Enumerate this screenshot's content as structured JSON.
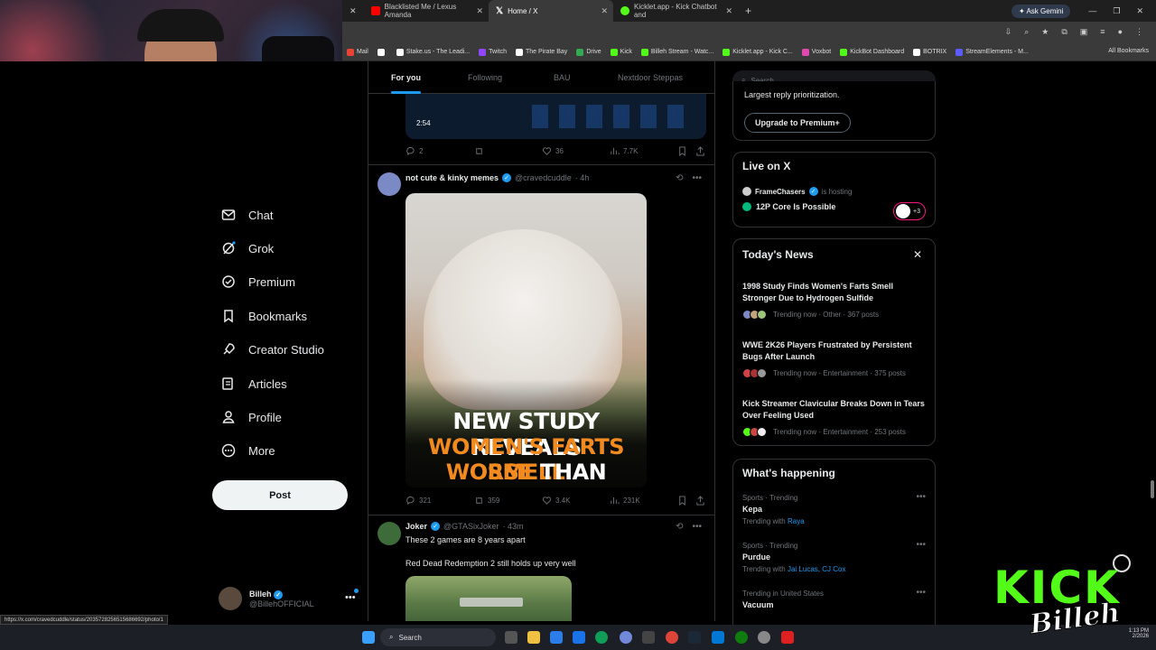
{
  "browser": {
    "tabs": [
      {
        "label": "Blacklisted Me / Lexus Amanda",
        "color": "#ff0000"
      },
      {
        "label": "Home / X",
        "color": "#ffffff"
      },
      {
        "label": "Kicklet.app - Kick Chatbot and",
        "color": "#53fc18"
      }
    ],
    "ask_gemini": "Ask Gemini",
    "bookmarks_all": "All Bookmarks",
    "bookmarks": [
      {
        "label": "Mail",
        "color": "#ea4335"
      },
      {
        "label": "",
        "color": "#ffffff"
      },
      {
        "label": "Stake.us - The Leadi...",
        "color": "#ffffff"
      },
      {
        "label": "Twitch",
        "color": "#9146ff"
      },
      {
        "label": "The Pirate Bay",
        "color": "#ffffff"
      },
      {
        "label": "Drive",
        "color": "#34a853"
      },
      {
        "label": "Kick",
        "color": "#53fc18"
      },
      {
        "label": "Billeh Stream - Watc...",
        "color": "#53fc18"
      },
      {
        "label": "Kicklet.app - Kick C...",
        "color": "#53fc18"
      },
      {
        "label": "Voxbot",
        "color": "#e04ab0"
      },
      {
        "label": "KickBot Dashboard",
        "color": "#53fc18"
      },
      {
        "label": "BOTRIX",
        "color": "#ffffff"
      },
      {
        "label": "StreamElements - M...",
        "color": "#5a5cff"
      }
    ]
  },
  "nav": {
    "items": [
      {
        "label": "Chat",
        "icon": "mail-icon"
      },
      {
        "label": "Grok",
        "icon": "grok-icon"
      },
      {
        "label": "Premium",
        "icon": "premium-icon"
      },
      {
        "label": "Bookmarks",
        "icon": "bookmark-icon"
      },
      {
        "label": "Creator Studio",
        "icon": "rocket-icon"
      },
      {
        "label": "Articles",
        "icon": "articles-icon"
      },
      {
        "label": "Profile",
        "icon": "profile-icon"
      },
      {
        "label": "More",
        "icon": "more-icon"
      }
    ],
    "post_label": "Post",
    "account": {
      "name": "Billeh",
      "handle": "@BillehOFFICIAL"
    }
  },
  "feed": {
    "tabs": [
      "For you",
      "Following",
      "BAU",
      "Nextdoor Steppas"
    ],
    "prev_post": {
      "video_time": "2:54",
      "replies": "2",
      "reposts": "",
      "likes": "36",
      "views": "7.7K"
    },
    "post1": {
      "name": "not cute & kinky memes",
      "handle": "@cravedcuddle",
      "time": "· 4h",
      "image_line1": "NEW STUDY REVEALS",
      "image_line2": "WOMEN'S FARTS SMELL",
      "image_line3a": "WORSE",
      "image_line3b": "THAN MEN'S",
      "replies": "321",
      "reposts": "359",
      "likes": "3.4K",
      "views": "231K"
    },
    "post2": {
      "name": "Joker",
      "handle": "@GTASixJoker",
      "time": "· 43m",
      "text1": "These 2 games are 8 years apart",
      "text2": "Red Dead Redemption 2 still holds up very well"
    }
  },
  "right": {
    "search_placeholder": "Search",
    "premium_text": "Largest reply prioritization.",
    "premium_button": "Upgrade to Premium+",
    "live": {
      "title": "Live on X",
      "host_name": "FrameChasers",
      "host_suffix": "is hosting",
      "stream_title": "12P Core Is Possible",
      "badge": "+3"
    },
    "news": {
      "title": "Today's News",
      "items": [
        {
          "headline": "1998 Study Finds Women's Farts Smell Stronger Due to Hydrogen Sulfide",
          "meta": "Trending now · Other · 367 posts"
        },
        {
          "headline": "WWE 2K26 Players Frustrated by Persistent Bugs After Launch",
          "meta": "Trending now · Entertainment · 375 posts"
        },
        {
          "headline": "Kick Streamer Clavicular Breaks Down in Tears Over Feeling Used",
          "meta": "Trending now · Entertainment · 253 posts"
        }
      ]
    },
    "happening": {
      "title": "What's happening",
      "trends": [
        {
          "category": "Sports · Trending",
          "name": "Kepa",
          "with_prefix": "Trending with",
          "with": "Raya"
        },
        {
          "category": "Sports · Trending",
          "name": "Purdue",
          "with_prefix": "Trending with",
          "with": "Jai Lucas, CJ Cox"
        },
        {
          "category": "Trending in United States",
          "name": "Vacuum",
          "with_prefix": "",
          "with": ""
        }
      ]
    }
  },
  "status_url": "https://x.com/cravedcuddle/status/2035728256515686692/photo/1",
  "taskbar": {
    "search": "Search",
    "time": "1:13 PM",
    "date": "2/2026"
  },
  "overlay": {
    "kick": "KICK",
    "signature": "Billeh"
  },
  "colors": {
    "accent": "#1d9bf0",
    "kick_green": "#53fc18",
    "background": "#000000"
  }
}
